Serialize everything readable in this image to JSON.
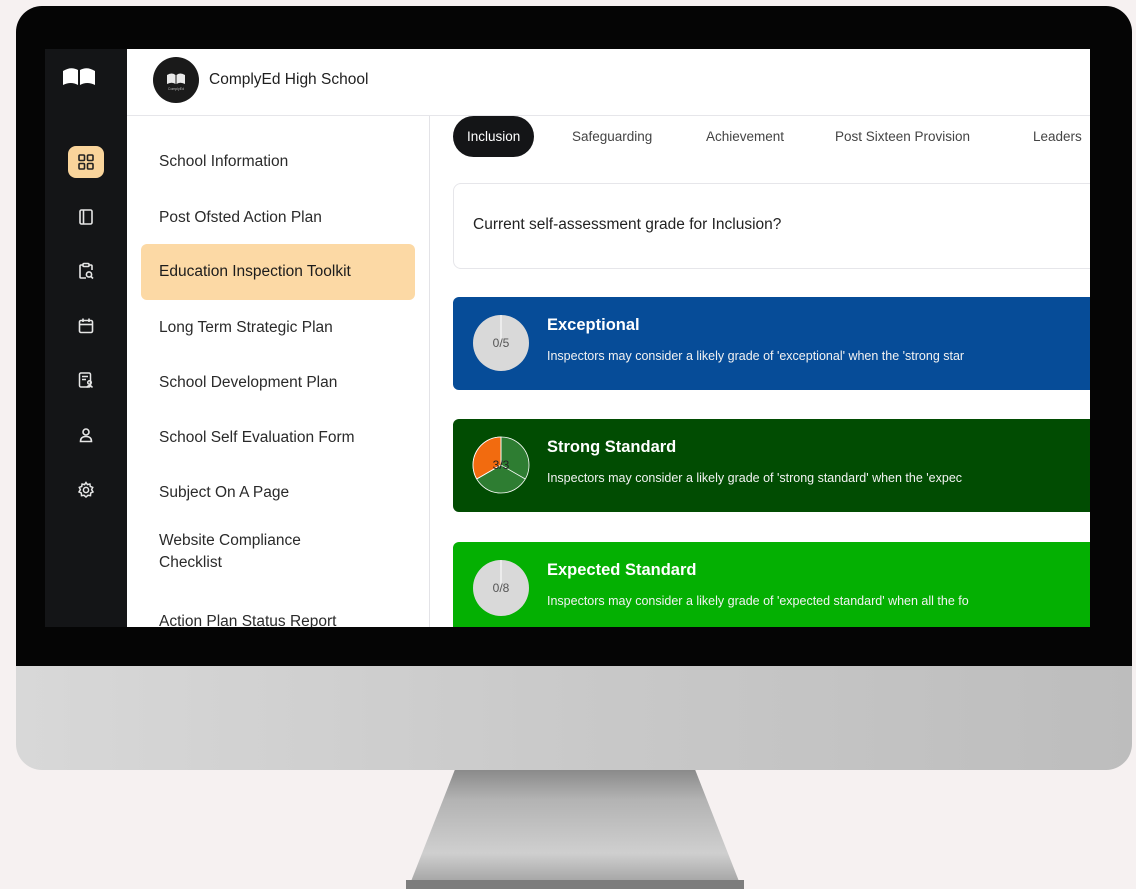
{
  "app": {
    "school_name": "ComplyEd High School",
    "avatar_text": "ComplyEd"
  },
  "rail": {
    "items": [
      {
        "icon": "dashboard-grid-icon",
        "active": true
      },
      {
        "icon": "book-icon",
        "active": false
      },
      {
        "icon": "clipboard-search-icon",
        "active": false
      },
      {
        "icon": "calendar-icon",
        "active": false
      },
      {
        "icon": "report-users-icon",
        "active": false
      },
      {
        "icon": "user-icon",
        "active": false
      },
      {
        "icon": "settings-gear-icon",
        "active": false
      }
    ]
  },
  "nav": {
    "items": [
      {
        "label": "School Information",
        "active": false
      },
      {
        "label": "Post Ofsted Action Plan",
        "active": false
      },
      {
        "label": "Education Inspection Toolkit",
        "active": true
      },
      {
        "label": "Long Term Strategic Plan",
        "active": false
      },
      {
        "label": "School Development Plan",
        "active": false
      },
      {
        "label": "School Self Evaluation Form",
        "active": false
      },
      {
        "label": "Subject On A Page",
        "active": false
      },
      {
        "label": "Website Compliance Checklist",
        "active": false
      },
      {
        "label": "Action Plan Status Report",
        "active": false
      }
    ]
  },
  "tabs": [
    {
      "label": "Inclusion",
      "active": true
    },
    {
      "label": "Safeguarding",
      "active": false
    },
    {
      "label": "Achievement",
      "active": false
    },
    {
      "label": "Post Sixteen Provision",
      "active": false
    },
    {
      "label": "Leaders",
      "active": false
    }
  ],
  "question": {
    "text": "Current self-assessment grade for Inclusion?"
  },
  "grades": [
    {
      "title": "Exceptional",
      "description": "Inspectors may consider a likely grade of 'exceptional' when the 'strong star",
      "progress_label": "0/5",
      "done": 0,
      "total": 5,
      "color": "#064c98"
    },
    {
      "title": "Strong Standard",
      "description": "Inspectors may consider a likely grade of 'strong standard' when the 'expec",
      "progress_label": "3/3",
      "done": 3,
      "total": 3,
      "color": "#014c02"
    },
    {
      "title": "Expected Standard",
      "description": "Inspectors may consider a likely grade of 'expected standard' when all the fo",
      "progress_label": "0/8",
      "done": 0,
      "total": 8,
      "color": "#04b002"
    }
  ],
  "colors": {
    "accent": "#fcd9a5",
    "rail_bg": "#141517",
    "pie_orange": "#f26b0f",
    "pie_green": "#2e7d32",
    "pie_empty": "#d9d9d9"
  }
}
